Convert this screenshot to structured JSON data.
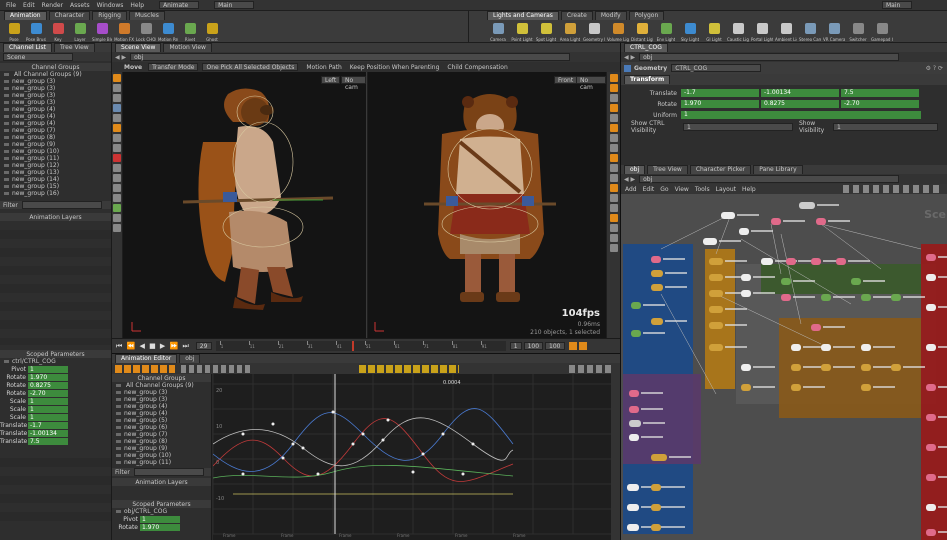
{
  "menubar": {
    "items": [
      "File",
      "Edit",
      "Render",
      "Assets",
      "Windows",
      "Help"
    ],
    "desktop": "Animate",
    "scene": "Main",
    "right_label": "Main"
  },
  "shelf_left": {
    "tabs": [
      "Animation",
      "Character",
      "Rigging",
      "Muscles"
    ],
    "tools": [
      "Pose",
      "Pose Brush",
      "Key",
      "Layer",
      "Simple Blend",
      "Motion FX",
      "Lock CHOP",
      "Motion Path",
      "Rivet",
      "Ghost"
    ]
  },
  "shelf_right": {
    "tabs": [
      "Lights and Cameras",
      "Create",
      "Modify",
      "Polygon"
    ],
    "tools": [
      "Camera",
      "Point Light",
      "Spot Light",
      "Area Light",
      "Geometry Light",
      "Volume Light",
      "Distant Light",
      "Env Light",
      "Sky Light",
      "GI Light",
      "Caustic Light",
      "Portal Light",
      "Ambient Light",
      "Stereo Camera",
      "VR Camera",
      "Switcher",
      "Gamepad Camera"
    ]
  },
  "left_panel": {
    "tabs": [
      "Channel List",
      "Tree View"
    ],
    "path": "Scene",
    "section_title": "Channel Groups",
    "all_groups": "All Channel Groups (9)",
    "groups": [
      "new_group (3)",
      "new_group (3)",
      "new_group (3)",
      "new_group (3)",
      "new_group (4)",
      "new_group (4)",
      "new_group (4)",
      "new_group (7)",
      "new_group (8)",
      "new_group (9)",
      "new_group (10)",
      "new_group (11)",
      "new_group (12)",
      "new_group (13)",
      "new_group (14)",
      "new_group (15)",
      "new_group (16)"
    ],
    "filter_label": "Filter",
    "anim_layers_title": "Animation Layers",
    "scoped_title": "Scoped Parameters",
    "scoped_root": "ctrl/CTRL_COG",
    "params": [
      {
        "label": "Pivot",
        "value": "1"
      },
      {
        "label": "Rotate",
        "value": "1.970"
      },
      {
        "label": "Rotate",
        "value": "0.8275"
      },
      {
        "label": "Rotate",
        "value": "-2.70"
      },
      {
        "label": "Scale",
        "value": "1"
      },
      {
        "label": "Scale",
        "value": "1"
      },
      {
        "label": "Scale",
        "value": "1"
      },
      {
        "label": "Translate",
        "value": "-1.7"
      },
      {
        "label": "Translate",
        "value": "-1.00134"
      },
      {
        "label": "Translate",
        "value": "7.5"
      }
    ]
  },
  "viewport": {
    "tabs": [
      "Scene View",
      "Motion View"
    ],
    "path": "obj",
    "toolbar": [
      "Move",
      "Transfer Mode",
      "One Pick All Selected Objects",
      "Motion Path",
      "Keep Position When Parenting",
      "Child Compensation"
    ],
    "left_cam": "Left",
    "left_cam2": "No cam",
    "right_cam": "Front",
    "right_cam2": "No cam",
    "fps": "104fps",
    "fps_sub": "0.96ms",
    "status": "210 objects, 1 selected"
  },
  "timeline": {
    "frame": "29",
    "start": "1",
    "end": "100",
    "end2": "100",
    "ticks": [
      "1",
      "11",
      "21",
      "31",
      "41",
      "51",
      "61",
      "71",
      "81",
      "91"
    ]
  },
  "anim_editor": {
    "tabs": [
      "Animation Editor",
      "obj"
    ],
    "channel_groups_title": "Channel Groups",
    "all_groups": "All Channel Groups (9)",
    "groups": [
      "new_group (3)",
      "new_group (3)",
      "new_group (4)",
      "new_group (4)",
      "new_group (5)",
      "new_group (6)",
      "new_group (7)",
      "new_group (8)",
      "new_group (9)",
      "new_group (10)",
      "new_group (11)"
    ],
    "filter_label": "Filter",
    "anim_layers_title": "Animation Layers",
    "scoped_title": "Scoped Parameters",
    "scoped_root": "obj/CTRL_COG",
    "params": [
      {
        "label": "Pivot",
        "value": "1"
      },
      {
        "label": "Rotate",
        "value": "1.970"
      }
    ],
    "graph_ylabels": [
      "20",
      "10",
      "0",
      "-10"
    ],
    "graph_xlabels": [
      "Frame",
      "Frame",
      "Frame",
      "Frame",
      "Frame",
      "Frame"
    ],
    "graph_value": "0.0004",
    "frame_input": "1",
    "frame_end": "100"
  },
  "params_panel": {
    "tabs": [
      "CTRL_COG"
    ],
    "path": "obj",
    "node_type": "Geometry",
    "node_name": "CTRL_COG",
    "tab": "Transform",
    "rows": [
      {
        "label": "Translate",
        "values": [
          "-1.7",
          "-1.00134",
          "7.5"
        ]
      },
      {
        "label": "Rotate",
        "values": [
          "1.970",
          "0.8275",
          "-2.70"
        ]
      },
      {
        "label": "Uniform",
        "values": [
          "1"
        ]
      }
    ],
    "vis_label": "Show CTRL Visibility",
    "vis_value": "1",
    "show_label": "Show Visibility",
    "show_value": "1"
  },
  "network": {
    "tabs": [
      "obj",
      "Tree View",
      "Character Picker",
      "Pane Library"
    ],
    "path": "obj",
    "menu": [
      "Add",
      "Edit",
      "Go",
      "View",
      "Tools",
      "Layout",
      "Help"
    ],
    "watermark": "Sce",
    "boxes": [
      {
        "color": "#1c4a8a"
      },
      {
        "color": "#b27a16"
      },
      {
        "color": "#5a3a6a"
      },
      {
        "color": "#5a5a5a"
      },
      {
        "color": "#3a5a2a"
      },
      {
        "color": "#8a5a1a"
      },
      {
        "color": "#9a1a1a"
      }
    ]
  },
  "colors": {
    "accent_orange": "#e08a1a",
    "param_green": "#3d8b3d",
    "timeline_red": "#c23a2a"
  }
}
